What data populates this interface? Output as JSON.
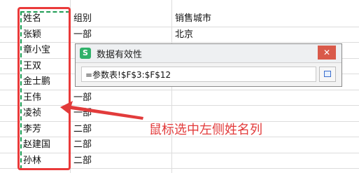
{
  "sheet": {
    "header": {
      "col_a": "姓名",
      "col_b": "组别",
      "col_c": "销售城市"
    },
    "rows": [
      {
        "a": "张颖",
        "b": "一部",
        "c": "北京"
      },
      {
        "a": "章小宝",
        "b": "",
        "c": ""
      },
      {
        "a": "王双",
        "b": "",
        "c": ""
      },
      {
        "a": "金士鹏",
        "b": "",
        "c": ""
      },
      {
        "a": "王伟",
        "b": "一部",
        "c": ""
      },
      {
        "a": "凌祯",
        "b": "一部",
        "c": ""
      },
      {
        "a": "李芳",
        "b": "二部",
        "c": ""
      },
      {
        "a": "赵建国",
        "b": "二部",
        "c": ""
      },
      {
        "a": "孙林",
        "b": "二部",
        "c": ""
      }
    ]
  },
  "dialog": {
    "title": "数据有效性",
    "app_icon_letter": "S",
    "formula": "=参数表!$F$3:$F$12",
    "close_glyph": "✕"
  },
  "annotation": {
    "text": "鼠标选中左侧姓名列"
  },
  "colors": {
    "arrow": "#e23b3b",
    "selection_green": "#1f9d55",
    "highlight_red": "#ea3a3a"
  }
}
